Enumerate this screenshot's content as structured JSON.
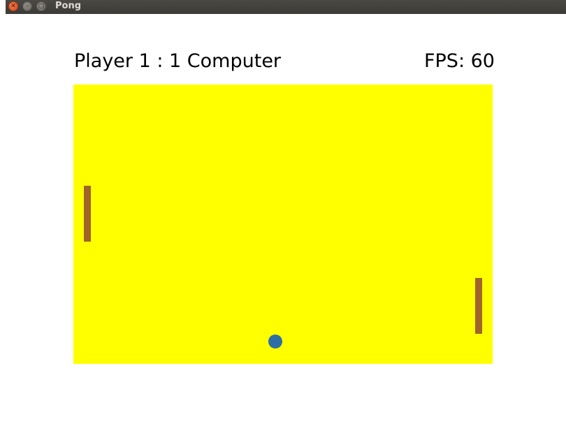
{
  "window": {
    "title": "Pong",
    "close_icon": "close-icon",
    "minimize_icon": "minimize-icon",
    "maximize_icon": "maximize-icon"
  },
  "hud": {
    "score_text": "Player 1 : 1 Computer",
    "fps_text": "FPS: 60"
  },
  "colors": {
    "field": "#ffff00",
    "paddle": "#a0642a",
    "ball": "#2e6ea6"
  }
}
